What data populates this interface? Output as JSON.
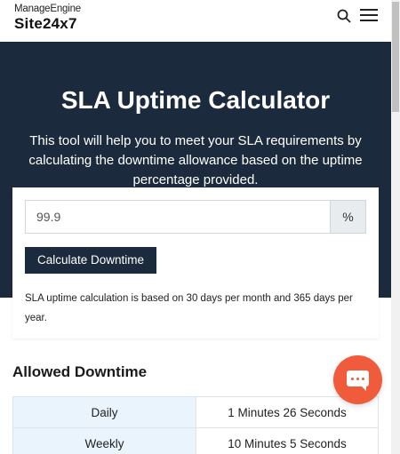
{
  "header": {
    "brand_top": "ManageEngine",
    "brand_main": "Site24x7",
    "search_icon": "search-icon",
    "menu_icon": "hamburger-menu-icon"
  },
  "hero": {
    "title": "SLA Uptime Calculator",
    "description": "This tool will help you to meet your SLA requirements by calculating the downtime allowance based on the uptime percentage provided.",
    "background_color": "#1c2a3d"
  },
  "calculator": {
    "uptime_value": "99.9",
    "unit": "%",
    "button_label": "Calculate Downtime",
    "note": "SLA uptime calculation is based on 30 days per month and 365 days per year."
  },
  "downtime": {
    "title": "Allowed Downtime",
    "rows": [
      {
        "period": "Daily",
        "value": "1 Minutes 26 Seconds"
      },
      {
        "period": "Weekly",
        "value": "10 Minutes 5 Seconds"
      }
    ]
  },
  "chat": {
    "icon": "chat-icon",
    "color": "#ef5b3b"
  }
}
